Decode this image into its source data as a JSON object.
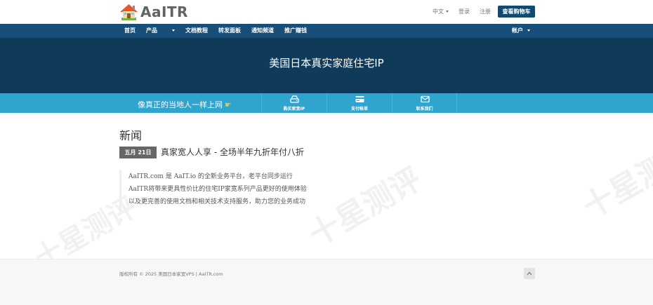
{
  "brand": {
    "logo_text": "AaITR"
  },
  "top_links": {
    "language": "中文",
    "login": "登录",
    "register": "注册",
    "cart_button": "查看购物车"
  },
  "nav": {
    "items": [
      "首页",
      "产品",
      "文档教程",
      "转发面板",
      "通知频道",
      "推广赚钱"
    ],
    "account": "帐户"
  },
  "hero": {
    "title": "美国日本真实家庭住宅IP"
  },
  "feature_bar": {
    "slogan": "像真正的当地人一样上网",
    "items": [
      {
        "label": "购买家宽IP",
        "icon": "router-icon"
      },
      {
        "label": "支付帐单",
        "icon": "credit-card-icon"
      },
      {
        "label": "联系我们",
        "icon": "envelope-icon"
      }
    ]
  },
  "news": {
    "heading": "新闻",
    "date_badge": "五月 21日",
    "title": "真家宽人人享 - 全场半年九折年付八折",
    "lines": [
      "AaITR.com 是 AaIT.io 的全新业务平台，老平台同步运行",
      "AaITR将带来更具性价比的住宅IP家宽系列产品更好的使用体验",
      "以及更完善的使用文档和相关技术支持服务，助力您的业务成功"
    ]
  },
  "footer": {
    "copyright": "版权所有 © 2025 美国日本家宽VPS | AaITR.com"
  },
  "watermark": "十星测评",
  "colors": {
    "topnav": "#174f7a",
    "hero": "#0f3a59",
    "feature_bar": "#2fa4cf",
    "cart_button": "#0f4a70",
    "badge": "#666666"
  }
}
